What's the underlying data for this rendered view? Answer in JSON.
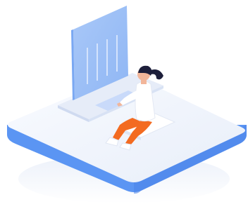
{
  "scene": {
    "subject": "isometric-workspace-illustration",
    "elements": [
      "platform",
      "holographic-monitor",
      "desk",
      "keyboard",
      "person",
      "stool"
    ]
  },
  "colors": {
    "background": "#ffffff",
    "platform_top": "#eef2fb",
    "platform_top_highlight": "#f7f9fe",
    "platform_side": "#5b95f3",
    "platform_side_dark": "#4a84e8",
    "monitor_fill": "#9cc0f7",
    "monitor_edge": "#7aa8f2",
    "monitor_bars": "#c8dcfb",
    "desk": "#e3eaf8",
    "keyboard": "#c9dafa",
    "shirt": "#ffffff",
    "pants": "#f36b21",
    "skin": "#f2b69a",
    "hair": "#1d1f3b",
    "shoes": "#ffffff"
  },
  "icons": {
    "monitor": "monitor-icon",
    "person": "person-icon"
  }
}
